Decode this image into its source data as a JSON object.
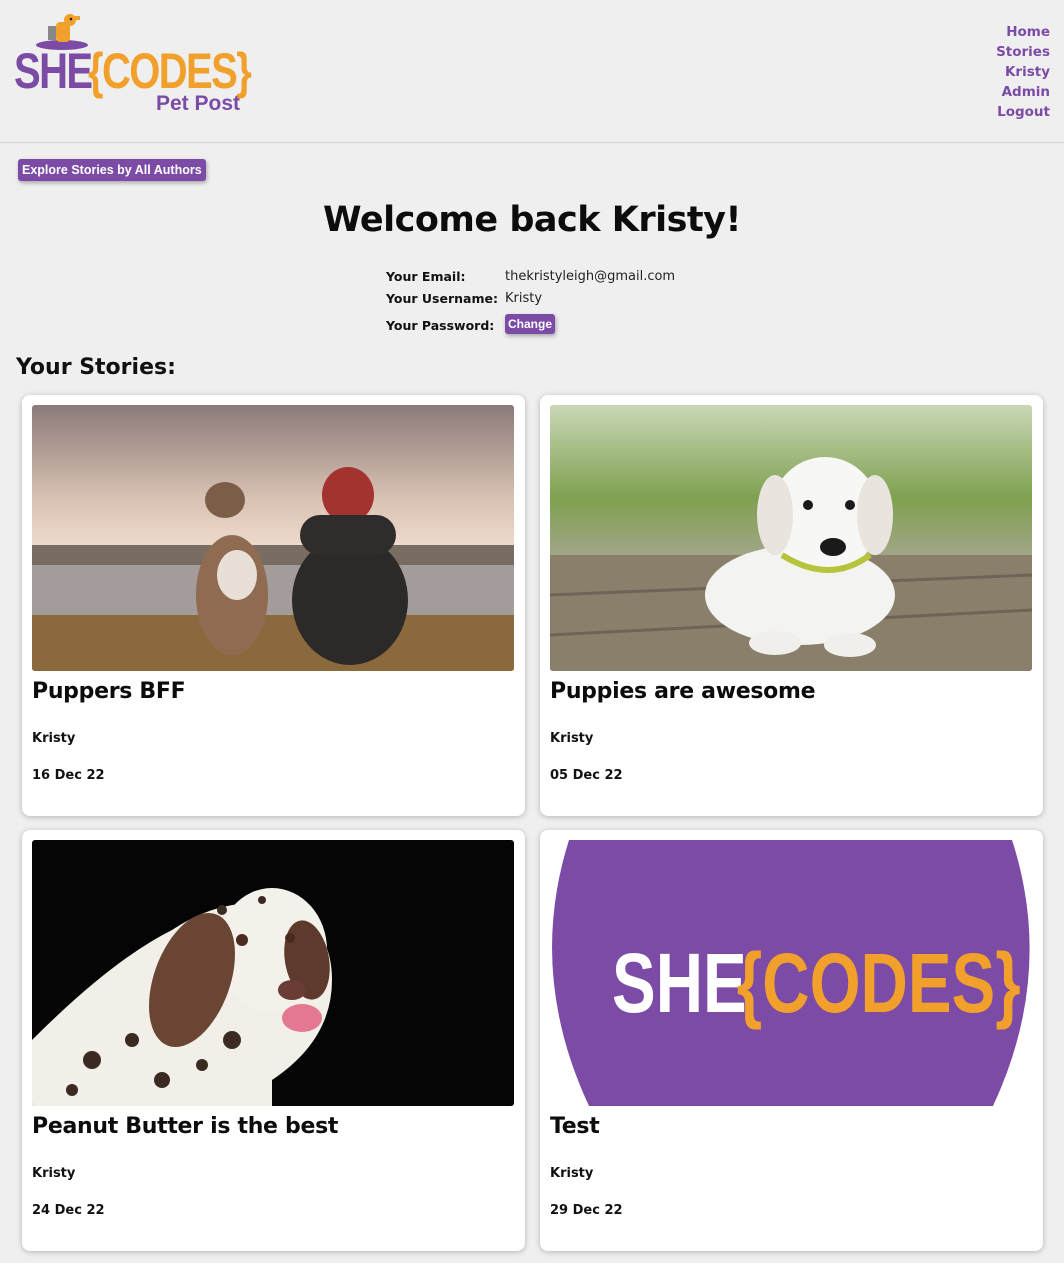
{
  "header": {
    "logo": {
      "she": "SHE",
      "codes": "{CODES}",
      "subtitle": "Pet Post"
    },
    "nav": [
      "Home",
      "Stories",
      "Kristy",
      "Admin",
      "Logout"
    ]
  },
  "explore_button": "Explore Stories by All Authors",
  "welcome": "Welcome back Kristy!",
  "profile": {
    "email_label": "Your Email:",
    "email": "thekristyleigh@gmail.com",
    "username_label": "Your Username:",
    "username": "Kristy",
    "password_label": "Your Password:",
    "change_button": "Change"
  },
  "stories_heading": "Your Stories:",
  "stories": [
    {
      "title": "Puppers BFF",
      "author": "Kristy",
      "date": "16 Dec 22",
      "image": "dog-and-woman-by-lake-photo"
    },
    {
      "title": "Puppies are awesome",
      "author": "Kristy",
      "date": "05 Dec 22",
      "image": "white-puppy-on-deck-photo"
    },
    {
      "title": "Peanut Butter is the best",
      "author": "Kristy",
      "date": "24 Dec 22",
      "image": "dalmatian-licking-lips-photo"
    },
    {
      "title": "Test",
      "author": "Kristy",
      "date": "29 Dec 22",
      "image": "shecodes-logo-image"
    }
  ],
  "colors": {
    "brand_purple": "#7b4ba6",
    "brand_orange": "#f2a02c",
    "background": "#efefef"
  }
}
